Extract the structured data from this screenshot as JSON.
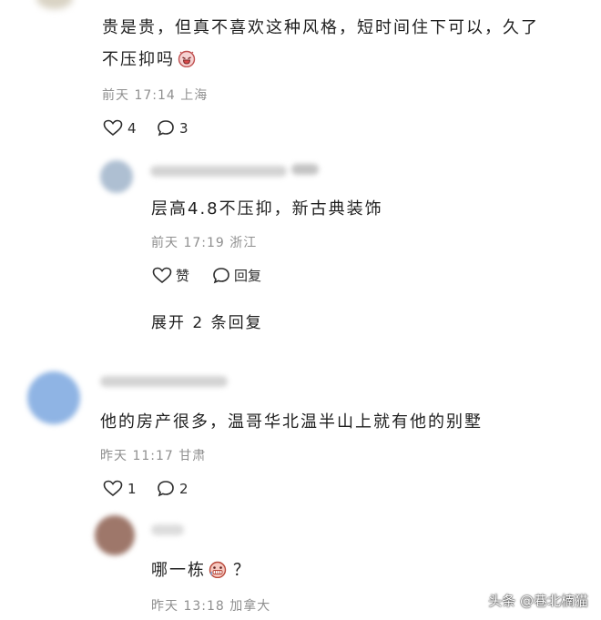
{
  "comments": [
    {
      "text_line1": "贵是贵，但真不喜欢这种风格，短时间住下可以，久了",
      "text_line2": "不压抑吗",
      "emoji": "crying-face-icon",
      "time": "前天 17:14",
      "location": "上海",
      "likes": "4",
      "replies_count": "3",
      "replies": [
        {
          "text": "层高4.8不压抑，新古典装饰",
          "time": "前天 17:19",
          "location": "浙江",
          "like_label": "赞",
          "reply_label": "回复"
        }
      ],
      "expand_label": "展开 2 条回复"
    },
    {
      "text": "他的房产很多，温哥华北温半山上就有他的别墅",
      "time": "昨天 11:17",
      "location": "甘肃",
      "likes": "1",
      "replies_count": "2",
      "replies": [
        {
          "text": "哪一栋",
          "emoji": "grimace-face-icon",
          "text_suffix": "？",
          "time": "昨天 13:18",
          "location": "加拿大"
        }
      ]
    }
  ],
  "watermark": "头条 @巷北楠猫",
  "colors": {
    "text": "#1f1f1f",
    "meta": "#8f8f8f",
    "background": "#ffffff"
  }
}
